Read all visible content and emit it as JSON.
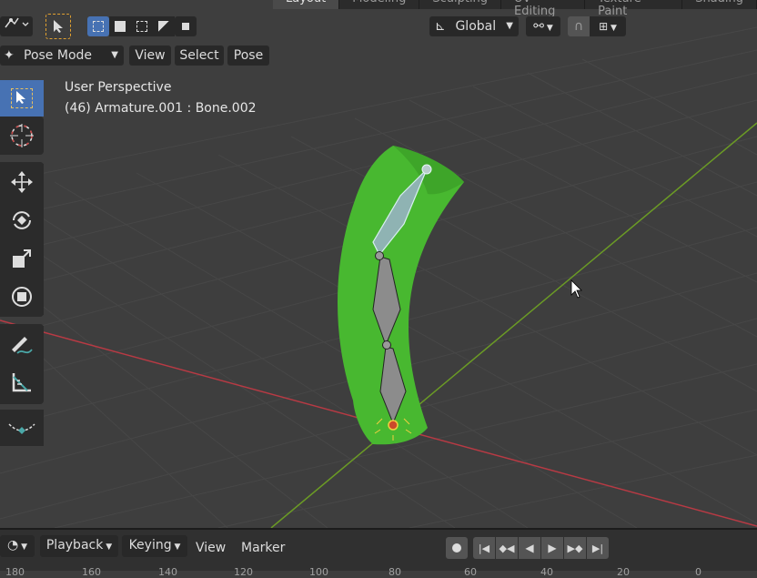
{
  "workspace_tabs": [
    "Layout",
    "Modeling",
    "Sculpting",
    "UV Editing",
    "Texture Paint",
    "Shading"
  ],
  "header": {
    "mode_label": "Pose Mode",
    "menu_view": "View",
    "menu_select": "Select",
    "menu_pose": "Pose",
    "transform_orientation": "Global"
  },
  "overlay": {
    "view_name": "User Perspective",
    "object_info": "(46) Armature.001 : Bone.002"
  },
  "toolbar": {
    "tools": [
      "select-box",
      "cursor",
      "move",
      "rotate",
      "scale",
      "transform",
      "annotate",
      "measure",
      "bone-roll"
    ],
    "active_tool": "select-box"
  },
  "timeline": {
    "playback_label": "Playback",
    "keying_label": "Keying",
    "view_label": "View",
    "marker_label": "Marker",
    "ruler_labels": [
      "180",
      "160",
      "140",
      "120",
      "100",
      "80",
      "60",
      "40",
      "20",
      "0"
    ]
  },
  "colors": {
    "accent": "#4772b3",
    "mesh": "#48b830",
    "x_axis": "#b83a44",
    "y_axis": "#6b9b25",
    "bone": "#8c8c8c",
    "selected_bone": "#8fb3b3"
  }
}
